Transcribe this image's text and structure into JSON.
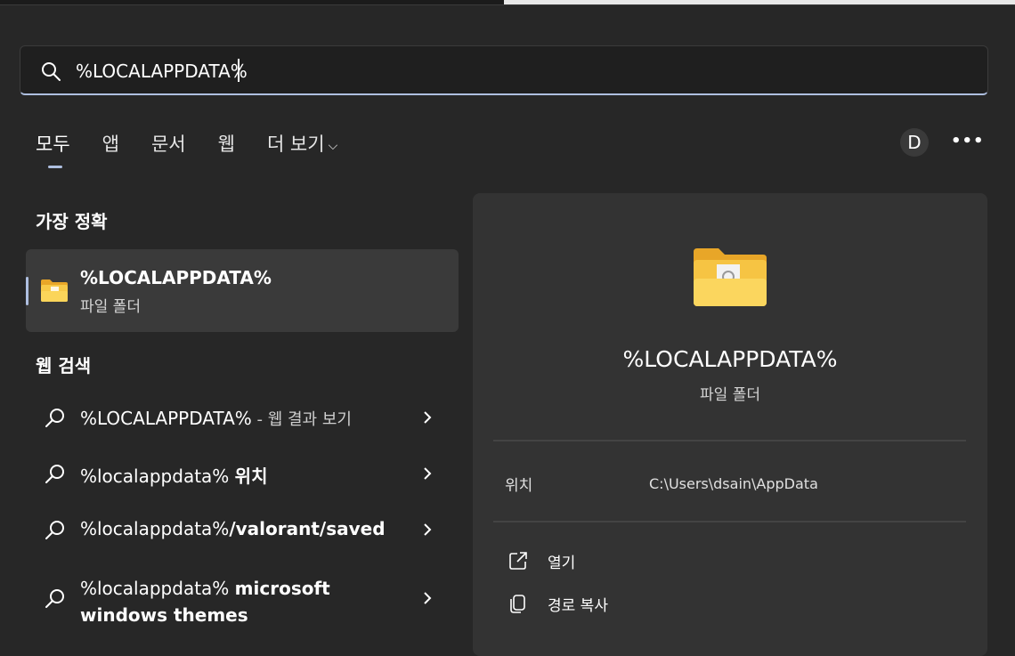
{
  "search": {
    "value": "%LOCALAPPDATA%",
    "icon": "search-icon"
  },
  "tabs": [
    {
      "label": "모두",
      "active": true
    },
    {
      "label": "앱"
    },
    {
      "label": "문서"
    },
    {
      "label": "웹"
    },
    {
      "label": "더 보기",
      "chevron": "⌵"
    }
  ],
  "header": {
    "avatar_letter": "D",
    "more_label": "•••"
  },
  "best_match": {
    "section_title": "가장 정확",
    "title": "%LOCALAPPDATA%",
    "subtitle": "파일 폴더",
    "icon": "folder-icon"
  },
  "web_search": {
    "section_title": "웹 검색",
    "items": [
      {
        "normal": "%LOCALAPPDATA%",
        "suffix": " - 웹 결과 보기"
      },
      {
        "normal": "%localappdata% ",
        "bold": "위치"
      },
      {
        "normal": "%localappdata%",
        "bold": "/valorant/saved"
      },
      {
        "normal": "%localappdata% ",
        "bold": "microsoft",
        "line2": "windows themes"
      }
    ]
  },
  "detail": {
    "title": "%LOCALAPPDATA%",
    "subtitle": "파일 폴더",
    "location_label": "위치",
    "location_value": "C:\\Users\\dsain\\AppData",
    "actions": [
      {
        "label": "열기",
        "icon": "open-external-icon"
      },
      {
        "label": "경로 복사",
        "icon": "copy-icon"
      }
    ]
  },
  "colors": {
    "accent": "#aebfe0",
    "background": "#272727",
    "panel": "#333333",
    "folder": "#f5c842"
  }
}
